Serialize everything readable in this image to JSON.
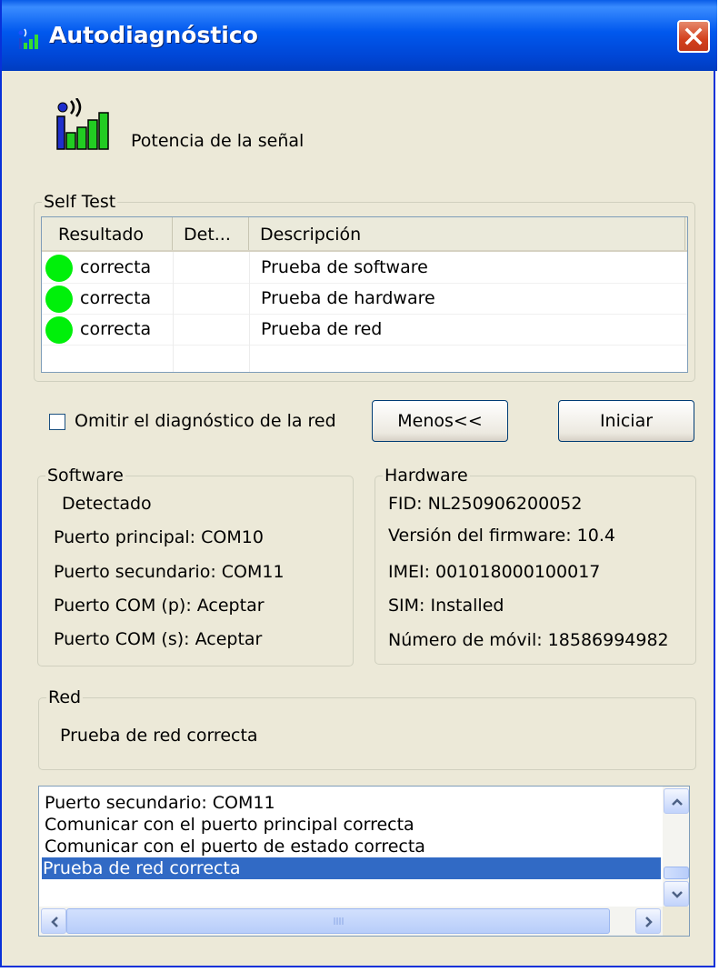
{
  "window": {
    "title": "Autodiagnóstico",
    "signal_label": "Potencia de la señal"
  },
  "self_test": {
    "group_title": "Self Test",
    "columns": [
      "Resultado",
      "Det...",
      "Descripción"
    ],
    "rows": [
      {
        "result": "correcta",
        "detail": "",
        "description": "Prueba de software",
        "status_color": "#00f00a"
      },
      {
        "result": "correcta",
        "detail": "",
        "description": "Prueba de hardware",
        "status_color": "#00f00a"
      },
      {
        "result": "correcta",
        "detail": "",
        "description": "Prueba de red",
        "status_color": "#00f00a"
      }
    ]
  },
  "options": {
    "skip_network_label": "Omitir el diagnóstico de la red",
    "skip_network_checked": false,
    "less_button": "Menos<<",
    "start_button": "Iniciar"
  },
  "software": {
    "group_title": "Software",
    "lines": [
      "Detectado",
      "Puerto principal: COM10",
      "Puerto secundario: COM11",
      "Puerto COM (p): Aceptar",
      "Puerto COM (s): Aceptar"
    ]
  },
  "hardware": {
    "group_title": "Hardware",
    "lines": [
      "FID: NL250906200052",
      "Versión del firmware: 10.4",
      "IMEI: 001018000100017",
      "SIM: Installed",
      "Número de móvil: 18586994982"
    ]
  },
  "network": {
    "group_title": "Red",
    "status": "Prueba de red correcta"
  },
  "log": {
    "items": [
      "Puerto secundario: COM11",
      "Comunicar con el puerto principal correcta",
      "Comunicar con el puerto de estado correcta",
      "Prueba de red correcta"
    ],
    "selected_index": 3
  },
  "colors": {
    "title_bar": "#0058ee",
    "selection": "#316ac5",
    "status_ok": "#00f00a"
  }
}
